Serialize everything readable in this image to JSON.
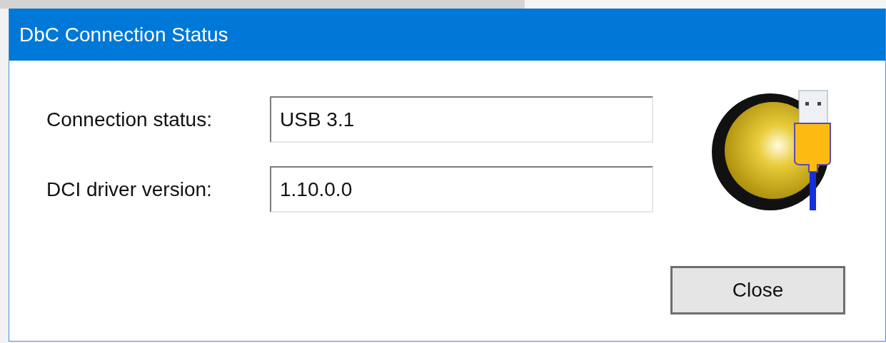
{
  "window": {
    "title": "DbC Connection Status"
  },
  "fields": [
    {
      "label": "Connection status:",
      "value": "USB 3.1"
    },
    {
      "label": "DCI driver version:",
      "value": "1.10.0.0"
    }
  ],
  "buttons": [
    "Close"
  ]
}
